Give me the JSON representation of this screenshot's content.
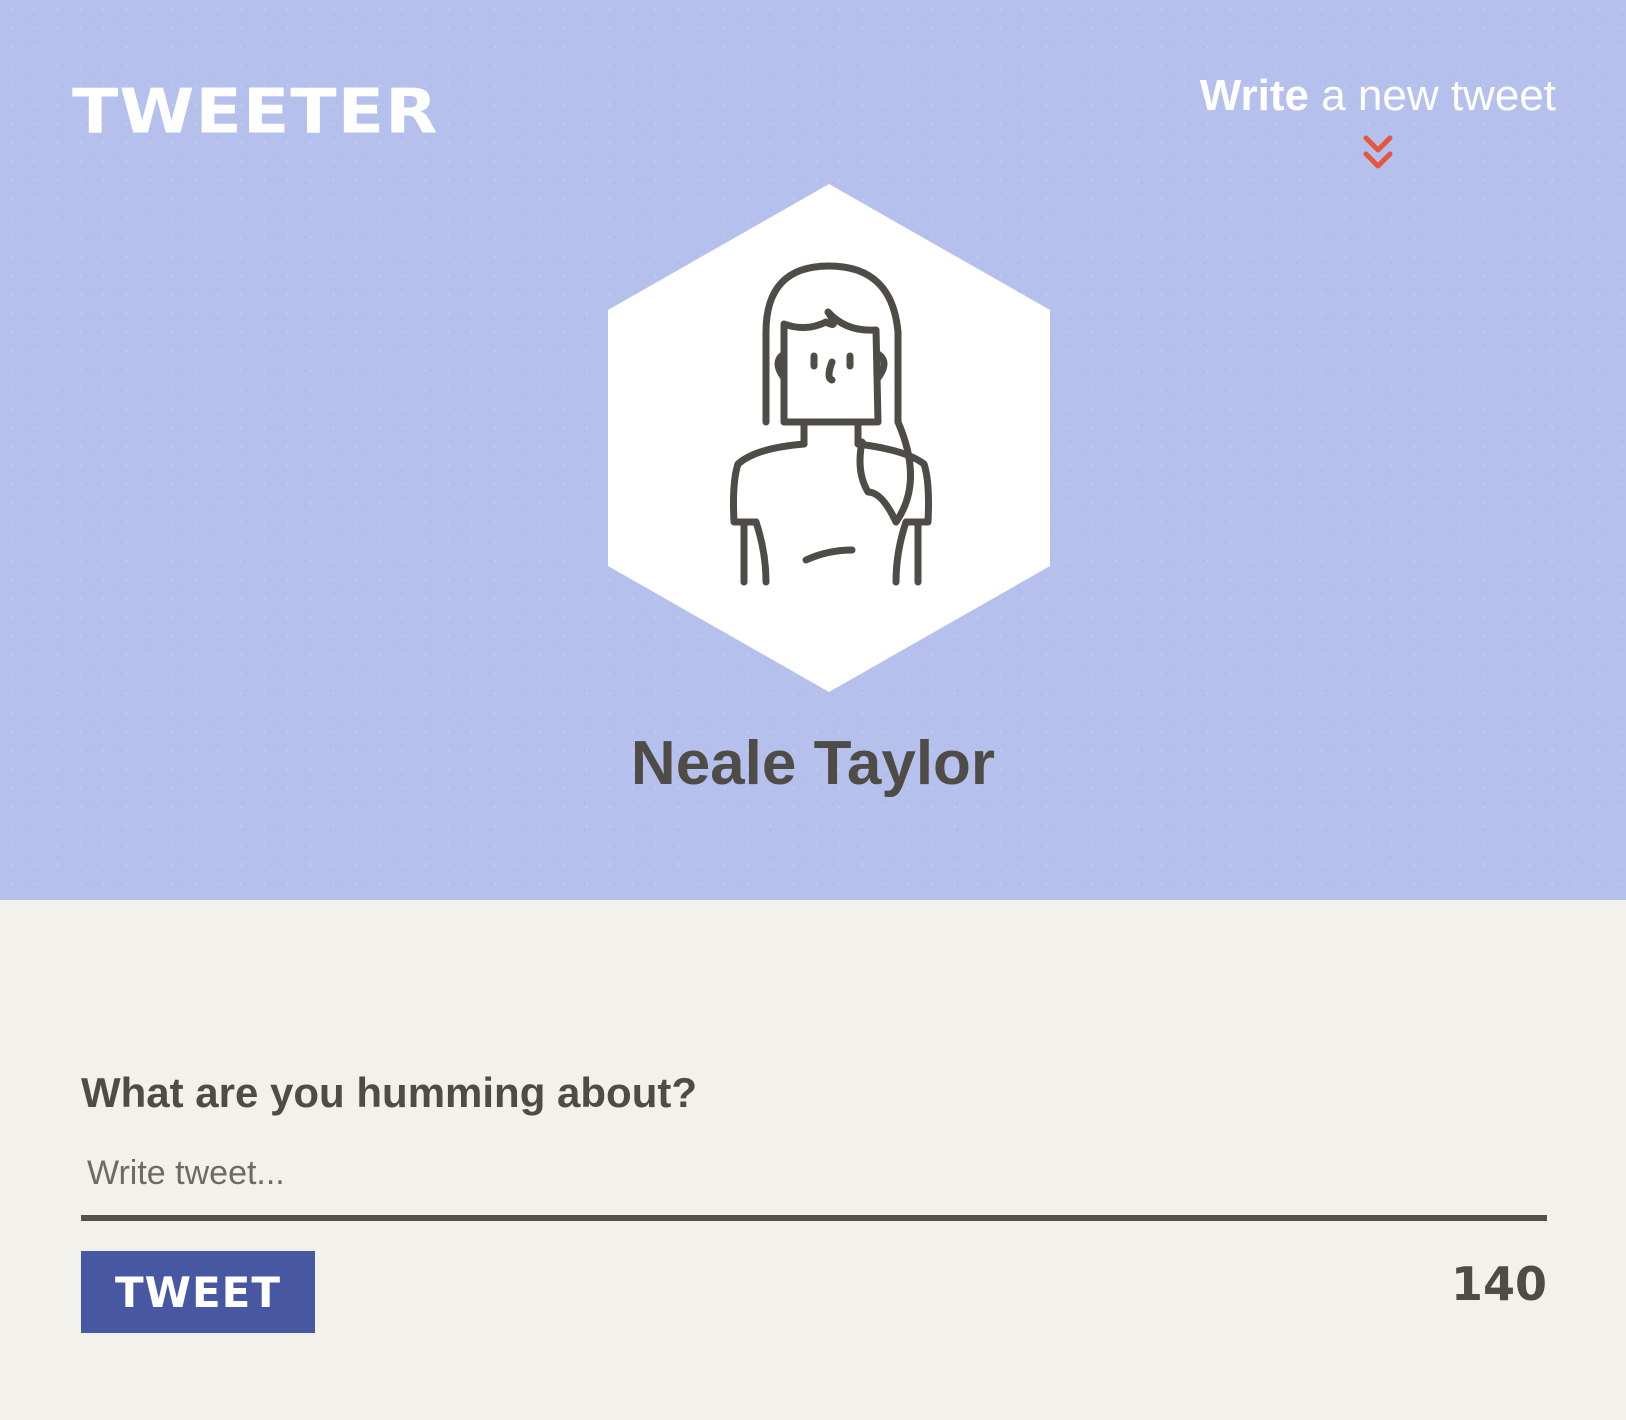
{
  "header": {
    "logo": "TWEETER",
    "nav": {
      "strong": "Write",
      "rest": " a new tweet",
      "icon": "double-chevron-down-icon",
      "accent_color": "#e4573c"
    },
    "background_color": "#b5c0ed"
  },
  "profile": {
    "name": "Neale Taylor",
    "avatar_icon": "woman-avatar-icon"
  },
  "compose": {
    "question": "What are you humming about?",
    "placeholder": "Write tweet...",
    "button_label": "TWEET",
    "counter": "140",
    "button_color": "#4757a1"
  }
}
